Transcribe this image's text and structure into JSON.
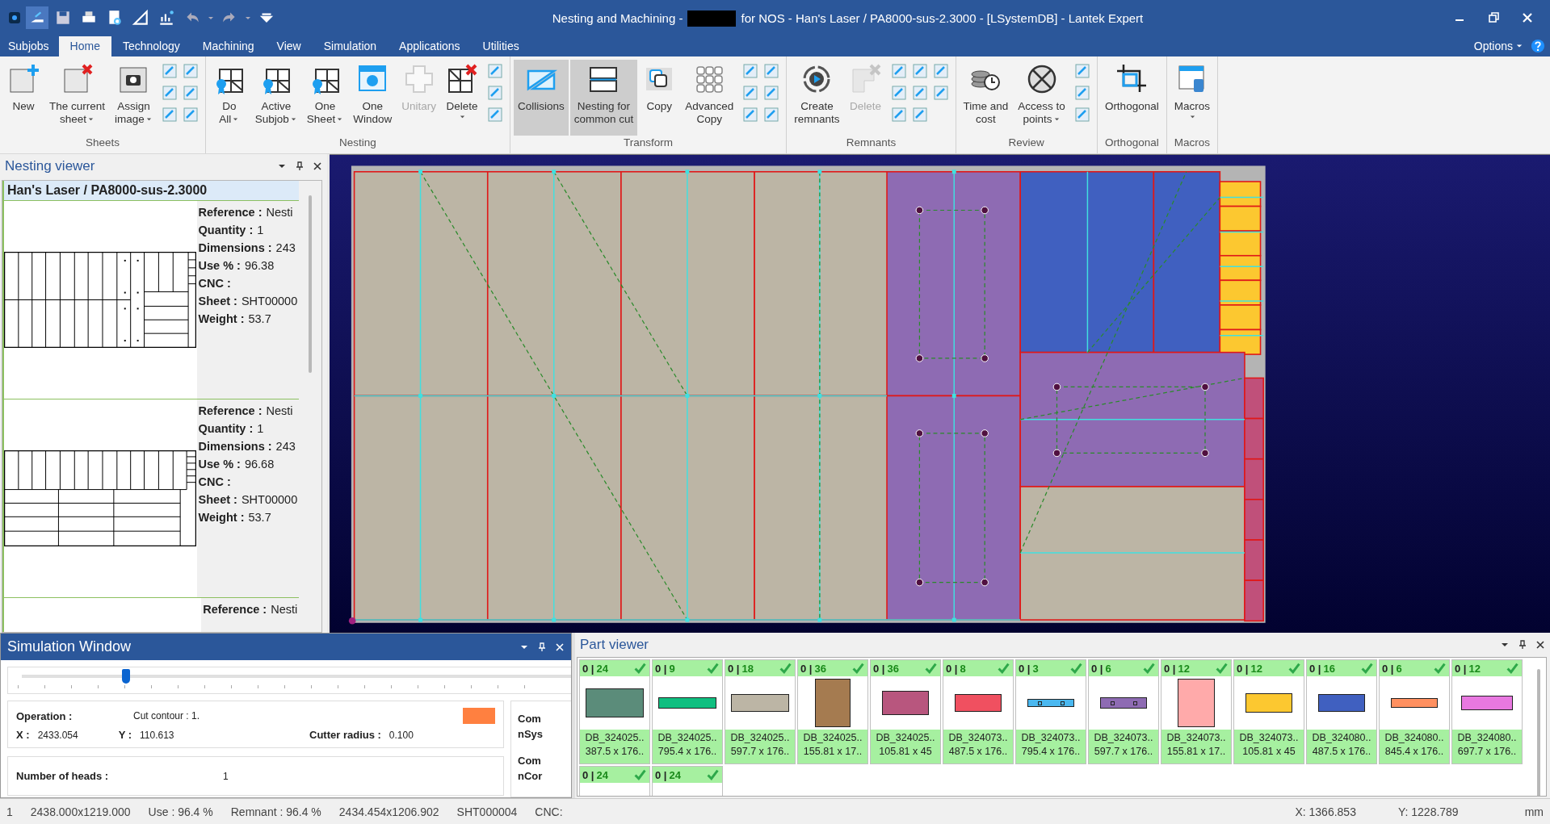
{
  "window": {
    "title_start": "Nesting and Machining -",
    "redacted": true,
    "title_end": "for NOS - Han's Laser / PA8000-sus-2.3000 - [LSystemDB] - Lantek Expert"
  },
  "tabs": [
    {
      "label": "Subjobs",
      "kind": "file",
      "selected": false
    },
    {
      "label": "Home",
      "kind": "tab",
      "selected": true
    },
    {
      "label": "Technology",
      "kind": "tab",
      "selected": false
    },
    {
      "label": "Machining",
      "kind": "tab",
      "selected": false
    },
    {
      "label": "View",
      "kind": "tab",
      "selected": false
    },
    {
      "label": "Simulation",
      "kind": "tab",
      "selected": false
    },
    {
      "label": "Applications",
      "kind": "tab",
      "selected": false
    },
    {
      "label": "Utilities",
      "kind": "tab",
      "selected": false
    }
  ],
  "options": {
    "label": "Options"
  },
  "ribbon": {
    "groups": [
      {
        "title": "Sheets",
        "buttons": [
          {
            "lines": [
              "New"
            ],
            "dropdown": false,
            "disabled": false,
            "selected": false
          },
          {
            "lines": [
              "The current",
              "sheet"
            ],
            "dropdown": true,
            "disabled": false,
            "selected": false
          },
          {
            "lines": [
              "Assign",
              "image"
            ],
            "dropdown": true,
            "disabled": false,
            "selected": false
          }
        ]
      },
      {
        "title": "Nesting",
        "buttons": [
          {
            "lines": [
              "Do",
              "All"
            ],
            "dropdown": true,
            "disabled": false,
            "selected": false
          },
          {
            "lines": [
              "Active",
              "Subjob"
            ],
            "dropdown": true,
            "disabled": false,
            "selected": false
          },
          {
            "lines": [
              "One",
              "Sheet"
            ],
            "dropdown": true,
            "disabled": false,
            "selected": false
          },
          {
            "lines": [
              "One",
              "Window"
            ],
            "dropdown": false,
            "disabled": false,
            "selected": false
          },
          {
            "lines": [
              "Unitary"
            ],
            "dropdown": false,
            "disabled": true,
            "selected": false
          },
          {
            "lines": [
              "Delete"
            ],
            "dropdown": true,
            "disabled": false,
            "selected": false
          }
        ]
      },
      {
        "title": "Transform",
        "buttons": [
          {
            "lines": [
              "Collisions"
            ],
            "dropdown": false,
            "disabled": false,
            "selected": true
          },
          {
            "lines": [
              "Nesting for",
              "common cut"
            ],
            "dropdown": false,
            "disabled": false,
            "selected": true
          },
          {
            "lines": [
              "Copy"
            ],
            "dropdown": false,
            "disabled": false,
            "selected": false
          },
          {
            "lines": [
              "Advanced",
              "Copy"
            ],
            "dropdown": false,
            "disabled": false,
            "selected": false
          }
        ]
      },
      {
        "title": "Remnants",
        "buttons": [
          {
            "lines": [
              "Create",
              "remnants"
            ],
            "dropdown": false,
            "disabled": false,
            "selected": false
          },
          {
            "lines": [
              "Delete"
            ],
            "dropdown": false,
            "disabled": true,
            "selected": false
          }
        ]
      },
      {
        "title": "Review",
        "buttons": [
          {
            "lines": [
              "Time and",
              "cost"
            ],
            "dropdown": false,
            "disabled": false,
            "selected": false
          },
          {
            "lines": [
              "Access to",
              "points"
            ],
            "dropdown": true,
            "disabled": false,
            "selected": false
          }
        ]
      },
      {
        "title": "Orthogonal",
        "buttons": [
          {
            "lines": [
              "Orthogonal"
            ],
            "dropdown": false,
            "disabled": false,
            "selected": false
          }
        ]
      },
      {
        "title": "Macros",
        "buttons": [
          {
            "lines": [
              "Macros"
            ],
            "dropdown": true,
            "disabled": false,
            "selected": false
          }
        ]
      }
    ]
  },
  "nesting_viewer": {
    "title": "Nesting viewer",
    "machine": "Han's Laser / PA8000-sus-2.3000",
    "sheets": [
      {
        "props": [
          {
            "label": "Reference :",
            "value": "Nesti"
          },
          {
            "label": "Quantity :",
            "value": "1"
          },
          {
            "label": "Dimensions :",
            "value": "243"
          },
          {
            "label": "Use % :",
            "value": "96.38"
          },
          {
            "label": "CNC :"
          },
          {
            "label": "Sheet :",
            "value": "SHT00000"
          },
          {
            "label": "Weight :",
            "value": "53.7"
          }
        ]
      },
      {
        "props": [
          {
            "label": "Reference :",
            "value": "Nesti"
          },
          {
            "label": "Quantity :",
            "value": "1"
          },
          {
            "label": "Dimensions :",
            "value": "243"
          },
          {
            "label": "Use % :",
            "value": "96.68"
          },
          {
            "label": "CNC :"
          },
          {
            "label": "Sheet :",
            "value": "SHT00000"
          },
          {
            "label": "Weight :",
            "value": "53.7"
          }
        ]
      },
      {
        "props": [
          {
            "label": "Reference :",
            "value": "Nesti"
          }
        ]
      }
    ]
  },
  "simulation": {
    "title": "Simulation Window",
    "slider": {
      "level": 0.19
    },
    "operation": {
      "label": "Operation :",
      "value": "Cut contour : 1.",
      "color": "#ff8040"
    },
    "x": {
      "label": "X :",
      "value": "2433.054"
    },
    "y": {
      "label": "Y :",
      "value": "110.613"
    },
    "cutter": {
      "label": "Cutter radius :",
      "value": "0.100"
    },
    "heads": {
      "label": "Number of heads :",
      "value": "1"
    },
    "side": [
      [
        "Com",
        "nSys"
      ],
      [
        "Com",
        "nCor"
      ]
    ]
  },
  "part_viewer": {
    "title": "Part viewer",
    "parts": [
      {
        "count": "0 |",
        "total": "24",
        "complete": true,
        "color": "#5b8c7a",
        "name": "DB_324025..",
        "size": "387.5 x 176.."
      },
      {
        "count": "0 |",
        "total": "9",
        "complete": true,
        "color": "#10bf80",
        "name": "DB_324025..",
        "size": "795.4 x 176.."
      },
      {
        "count": "0 |",
        "total": "18",
        "complete": true,
        "color": "#bcb5a5",
        "name": "DB_324025..",
        "size": "597.7 x 176.."
      },
      {
        "count": "0 |",
        "total": "36",
        "complete": true,
        "color": "#a57b50",
        "name": "DB_324025..",
        "size": "155.81 x 17.."
      },
      {
        "count": "0 |",
        "total": "36",
        "complete": true,
        "color": "#b8567e",
        "name": "DB_324025..",
        "size": "105.81 x 45"
      },
      {
        "count": "0 |",
        "total": "8",
        "complete": true,
        "color": "#f05060",
        "name": "DB_324073..",
        "size": "487.5 x 176.."
      },
      {
        "count": "0 |",
        "total": "3",
        "complete": true,
        "color": "#4ab8f0",
        "name": "DB_324073..",
        "size": "795.4 x 176.."
      },
      {
        "count": "0 |",
        "total": "6",
        "complete": true,
        "color": "#8e6bb3",
        "name": "DB_324073..",
        "size": "597.7 x 176.."
      },
      {
        "count": "0 |",
        "total": "12",
        "complete": true,
        "color": "#ffaaaa",
        "name": "DB_324073..",
        "size": "155.81 x 17.."
      },
      {
        "count": "0 |",
        "total": "12",
        "complete": true,
        "color": "#fcc830",
        "name": "DB_324073..",
        "size": "105.81 x 45"
      },
      {
        "count": "0 |",
        "total": "16",
        "complete": true,
        "color": "#4060c0",
        "name": "DB_324080..",
        "size": "487.5 x 176.."
      },
      {
        "count": "0 |",
        "total": "6",
        "complete": true,
        "color": "#ff9060",
        "name": "DB_324080..",
        "size": "845.4 x 176.."
      },
      {
        "count": "0 |",
        "total": "12",
        "complete": true,
        "color": "#e878e0",
        "name": "DB_324080..",
        "size": "697.7 x 176.."
      },
      {
        "count": "0 |",
        "total": "24",
        "complete": true
      },
      {
        "count": "0 |",
        "total": "24",
        "complete": true
      }
    ]
  },
  "status_bar": {
    "items": [
      "1",
      "2438.000x1219.000",
      "Use : 96.4 %",
      "Remnant : 96.4 %",
      "2434.454x1206.902",
      "SHT000004",
      "CNC:"
    ],
    "coords": [
      "X: 1366.853",
      "Y: 1228.789"
    ],
    "unit": "mm"
  }
}
